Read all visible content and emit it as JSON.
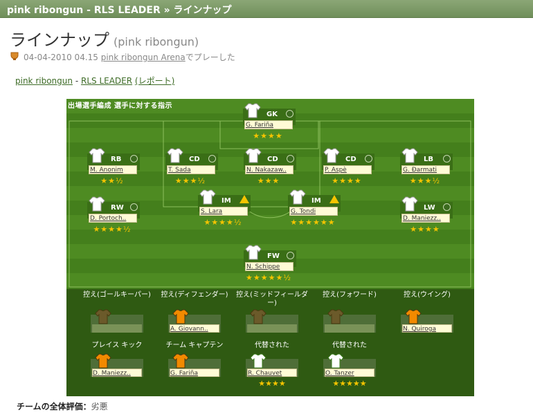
{
  "titlebar": "pink ribongun - RLS LEADER » ラインナップ",
  "heading": {
    "title": "ラインナップ",
    "sub": "(pink ribongun)"
  },
  "match": {
    "datetime": "04-04-2010 04.15",
    "venue": "pink ribongun Arena",
    "suffix": "でプレーした"
  },
  "links": {
    "home": "pink ribongun",
    "sep": "-",
    "away": "RLS LEADER",
    "report": "(レポート)"
  },
  "tabs": "出場選手編成 選手に対する指示",
  "colors": {
    "titlebar": "#7a9664",
    "pitch": "#4e8b22",
    "bench": "#2f5a12",
    "star": "#f5c400"
  },
  "players": [
    {
      "pos": "GK",
      "name": "G. Fariña",
      "stars": "★★★★",
      "status": "ok"
    },
    {
      "pos": "RB",
      "name": "M. Anonim",
      "stars": "★★½",
      "status": "ok"
    },
    {
      "pos": "CD",
      "name": "T. Sada",
      "stars": "★★★½",
      "status": "ok"
    },
    {
      "pos": "CD",
      "name": "N. Nakazaw..",
      "stars": "★★★",
      "status": "ok"
    },
    {
      "pos": "CD",
      "name": "P. Aspè",
      "stars": "★★★★",
      "status": "ok"
    },
    {
      "pos": "LB",
      "name": "G. Đarmati",
      "stars": "★★★½",
      "status": "ok"
    },
    {
      "pos": "RW",
      "name": "D. Portoch..",
      "stars": "★★★★½",
      "status": "ok"
    },
    {
      "pos": "IM",
      "name": "S. Lara",
      "stars": "★★★★½",
      "status": "warn"
    },
    {
      "pos": "IM",
      "name": "G. Tondi",
      "stars": "★★★★★★",
      "status": "warn"
    },
    {
      "pos": "LW",
      "name": "D. Maniezz..",
      "stars": "★★★★",
      "status": "ok"
    },
    {
      "pos": "FW",
      "name": "N. Schippe",
      "stars": "★★★★★½",
      "status": "ok"
    }
  ],
  "bench": {
    "labels": [
      "控え(ゴールキーパー)",
      "控え(ディフェンダー)",
      "控え(ミッドフィールダー)",
      "控え(フォワード)",
      "控え(ウイング)"
    ],
    "names": [
      "",
      "A. Giovann..",
      "",
      "",
      "N. Quiroga"
    ]
  },
  "special": {
    "labels": [
      "プレイス キック",
      "チーム キャプテン",
      "代替された",
      "代替された"
    ],
    "names": [
      "D. Maniezz..",
      "G. Fariña",
      "R. Chauvet",
      "O. Tanzer"
    ],
    "stars": [
      "",
      "",
      "★★★★",
      "★★★★★"
    ]
  },
  "rating": {
    "label": "チームの全体評価：",
    "value": "劣悪"
  }
}
